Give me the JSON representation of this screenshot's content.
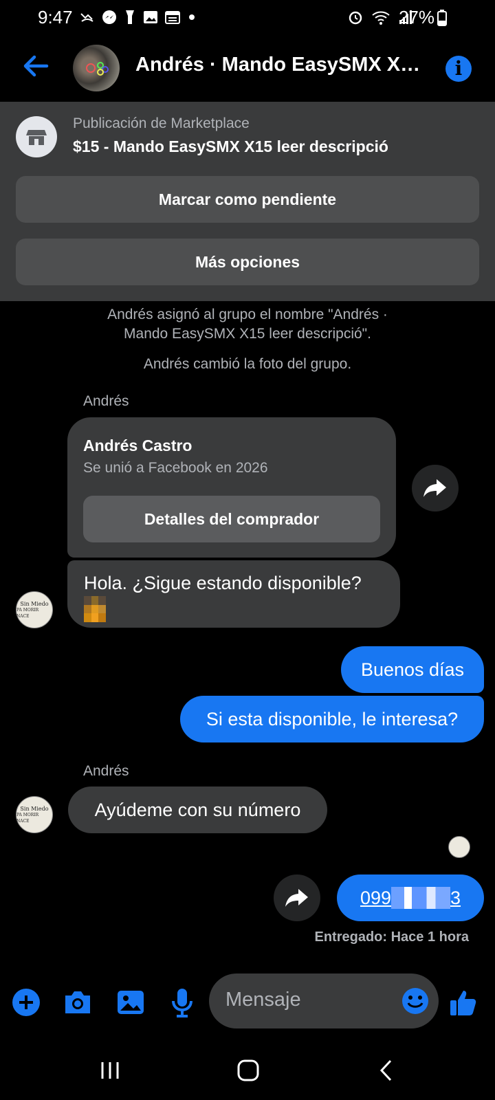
{
  "status_bar": {
    "time": "9:47",
    "battery": "27%",
    "left_icons": [
      "missed-call-icon",
      "messenger-icon",
      "flashlight-icon",
      "gallery-icon",
      "calendar-icon",
      "dot-icon"
    ],
    "right_icons": [
      "alarm-icon",
      "wifi-icon",
      "signal-icon",
      "battery-icon"
    ]
  },
  "header": {
    "title": "Andrés · Mando EasySMX X1...",
    "back_icon": "arrow-left-icon",
    "info_icon": "info-icon"
  },
  "marketplace": {
    "label": "Publicación de Marketplace",
    "listing_title": "$15 - Mando EasySMX X15 leer descripció",
    "mark_pending_label": "Marcar como pendiente",
    "more_options_label": "Más opciones"
  },
  "notices": {
    "rename_line1": "Andrés asignó al grupo el nombre \"Andrés ·",
    "rename_line2": "Mando EasySMX X15 leer descripció\".",
    "photo_changed": "Andrés cambió la foto del grupo."
  },
  "buyer_card": {
    "sender": "Andrés",
    "name": "Andrés Castro",
    "joined": "Se unió a Facebook en 2026",
    "details_label": "Detalles del comprador"
  },
  "avatar_text": [
    "Sin Miedo",
    "PA MORIR NACE"
  ],
  "messages": {
    "in1": "Hola. ¿Sigue estando disponible?",
    "out1": "Buenos días",
    "out2": "Si esta disponible, le interesa?",
    "sender2": "Andrés",
    "in2": "Ayúdeme con su número",
    "phone_prefix": "099",
    "phone_suffix": "3",
    "delivery": "Entregado: Hace 1 hora"
  },
  "composer": {
    "placeholder": "Mensaje",
    "icons": [
      "plus-icon",
      "camera-icon",
      "gallery-icon",
      "microphone-icon",
      "emoji-icon",
      "thumbs-up-icon"
    ]
  },
  "colors": {
    "accent": "#1877f2",
    "panel": "#3a3b3c",
    "background": "#000000"
  }
}
